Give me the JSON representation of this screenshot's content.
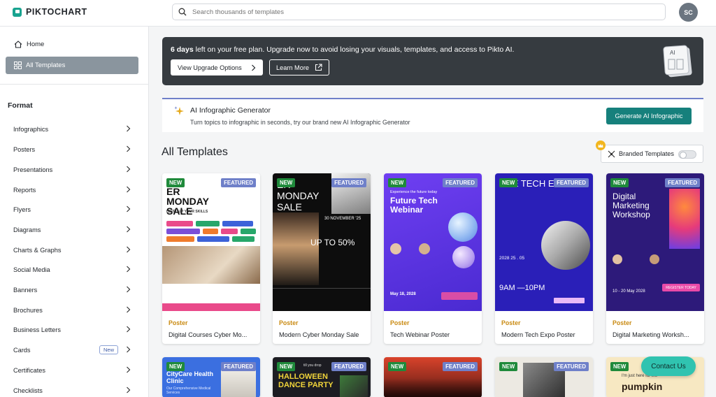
{
  "header": {
    "logo": "PIKTOCHART",
    "search_placeholder": "Search thousands of templates",
    "avatar_initials": "SC"
  },
  "sidebar": {
    "home": "Home",
    "all_templates": "All Templates",
    "format_heading": "Format",
    "categories": [
      {
        "label": "Infographics"
      },
      {
        "label": "Posters"
      },
      {
        "label": "Presentations"
      },
      {
        "label": "Reports"
      },
      {
        "label": "Flyers"
      },
      {
        "label": "Diagrams"
      },
      {
        "label": "Charts & Graphs"
      },
      {
        "label": "Social Media"
      },
      {
        "label": "Banners"
      },
      {
        "label": "Brochures"
      },
      {
        "label": "Business Letters"
      },
      {
        "label": "Cards",
        "badge": "New"
      },
      {
        "label": "Certificates"
      },
      {
        "label": "Checklists"
      }
    ]
  },
  "banner": {
    "days": "6 days",
    "message": " left on your free plan. Upgrade now to avoid losing your visuals, templates, and access to Pikto AI.",
    "upgrade_label": "View Upgrade Options",
    "learn_label": "Learn More",
    "ai_tag": "AI"
  },
  "ai_generator": {
    "title": "AI Infographic Generator",
    "subtitle": "Turn topics to infographic in seconds, try our brand new AI Infographic Generator",
    "button": "Generate AI Infographic"
  },
  "templates": {
    "title": "All Templates",
    "branded_label": "Branded Templates",
    "new_badge": "NEW",
    "featured_badge": "FEATURED",
    "cards": [
      {
        "category": "Poster",
        "name": "Digital Courses Cyber Mo...",
        "thumb_text": "ER MONDAY SALE",
        "thumb_sub": "LEVEL UP YOUR SKILLS"
      },
      {
        "category": "Poster",
        "name": "Modern Cyber Monday Sale",
        "thumb_text": "ER MONDAY SALE",
        "thumb_sub": "30 NOVEMBER '25",
        "thumb_extra": "UP TO 50%"
      },
      {
        "category": "Poster",
        "name": "Tech Webinar Poster",
        "thumb_text": "Future Tech Webinar",
        "thumb_sub": "Experience the future today",
        "thumb_extra": "May 18, 2028"
      },
      {
        "category": "Poster",
        "name": "Modern Tech Expo Poster",
        "thumb_text": "URE TECH EXPO",
        "thumb_sub": "9AM —10PM",
        "thumb_extra": "2028   25 . 05"
      },
      {
        "category": "Poster",
        "name": "Digital Marketing Worksh...",
        "thumb_text": "Digital Marketing Workshop",
        "thumb_sub": "REGISTER TODAY",
        "thumb_extra": "10 - 20 May 2028"
      }
    ],
    "second_row": [
      {
        "thumb_text": "CityCare Health Clinic",
        "thumb_sub": "Our Comprehensive Medical Services"
      },
      {
        "thumb_text": "HALLOWEEN DANCE PARTY",
        "thumb_sub": "till you drop"
      },
      {
        "thumb_text": "",
        "thumb_sub": ""
      },
      {
        "thumb_text": "",
        "thumb_sub": ""
      },
      {
        "thumb_text": "pumpkin",
        "thumb_sub": "I'm just here for the"
      }
    ]
  },
  "contact_label": "Contact Us",
  "colors": {
    "brand": "#18a38f",
    "featured": "#6f80c9",
    "new": "#1f8a3b",
    "generate": "#16807c"
  }
}
